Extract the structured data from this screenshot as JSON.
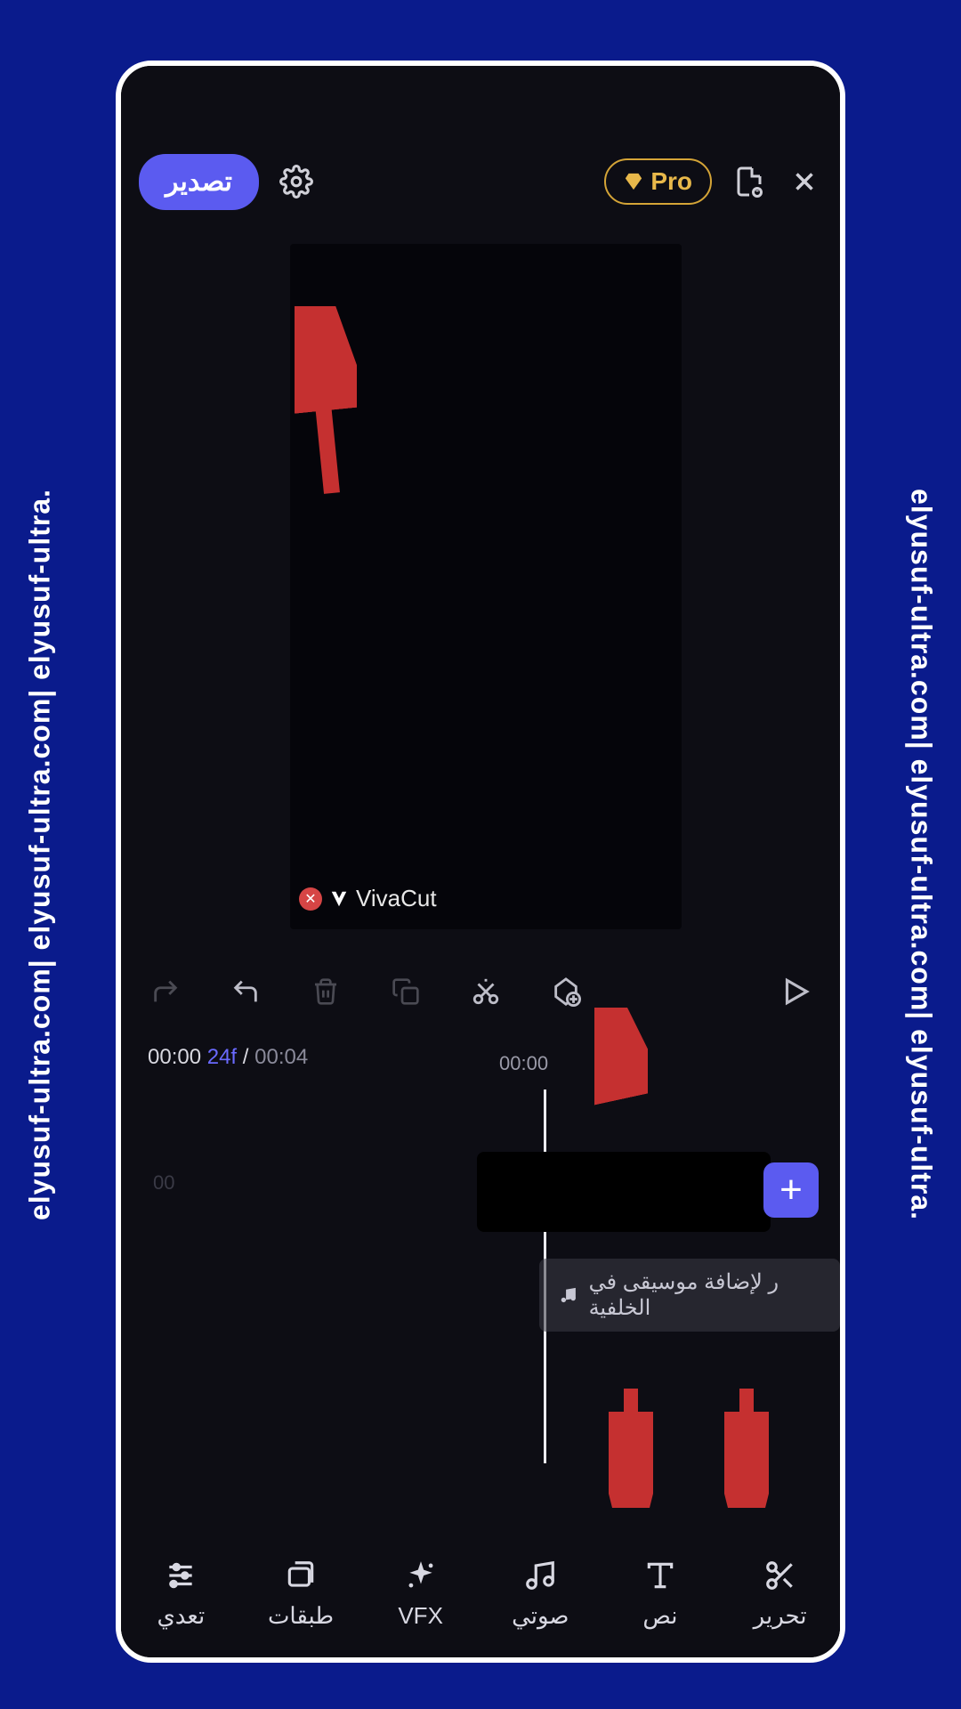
{
  "watermark_text": "elyusuf-ultra.com| elyusuf-ultra.com| elyusuf-ultra.",
  "topbar": {
    "export_label": "تصدير",
    "pro_label": "Pro"
  },
  "preview": {
    "watermark_app": "VivaCut"
  },
  "time": {
    "current": "00:00",
    "frames": "24f",
    "separator": "/",
    "total": "00:04",
    "ruler_mark": "00:00"
  },
  "timeline": {
    "music_hint": "ر لإضافة موسيقى في الخلفية",
    "faint_label": "00"
  },
  "bottom": {
    "adjust": "تعدي",
    "layers": "طبقات",
    "vfx": "VFX",
    "audio": "صوتي",
    "text": "نص",
    "edit": "تحرير"
  }
}
